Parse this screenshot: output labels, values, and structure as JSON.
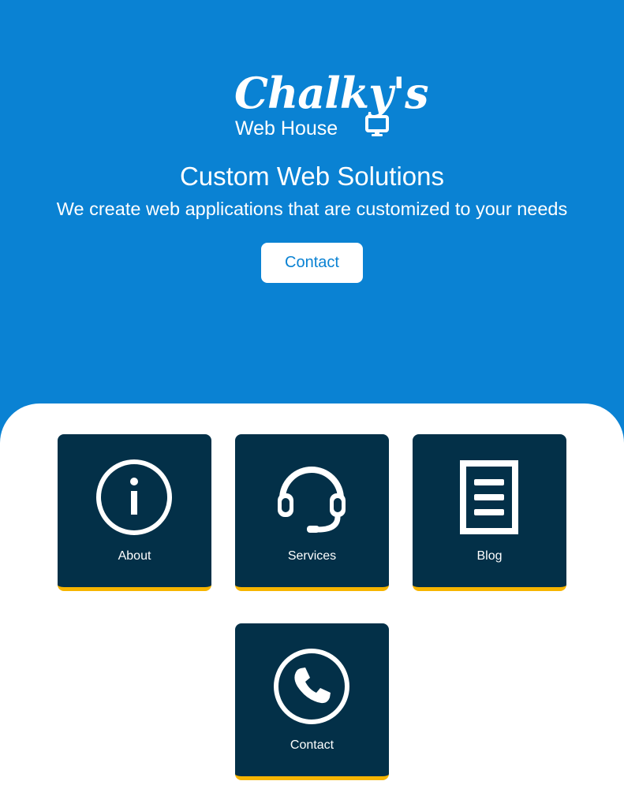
{
  "logo": {
    "script_text": "Chalky's",
    "sub_text": "Web House",
    "icon": "monitor-icon"
  },
  "hero": {
    "title": "Custom Web Solutions",
    "subtitle": "We create web applications that are customized to your needs",
    "button_label": "Contact"
  },
  "cards": [
    {
      "label": "About",
      "icon": "info-icon"
    },
    {
      "label": "Services",
      "icon": "headset-icon"
    },
    {
      "label": "Blog",
      "icon": "document-icon"
    },
    {
      "label": "Contact",
      "icon": "phone-icon"
    }
  ],
  "colors": {
    "hero_background": "#0a82d3",
    "card_background": "#033048",
    "card_accent": "#f7b500",
    "content_background": "#ffffff"
  }
}
